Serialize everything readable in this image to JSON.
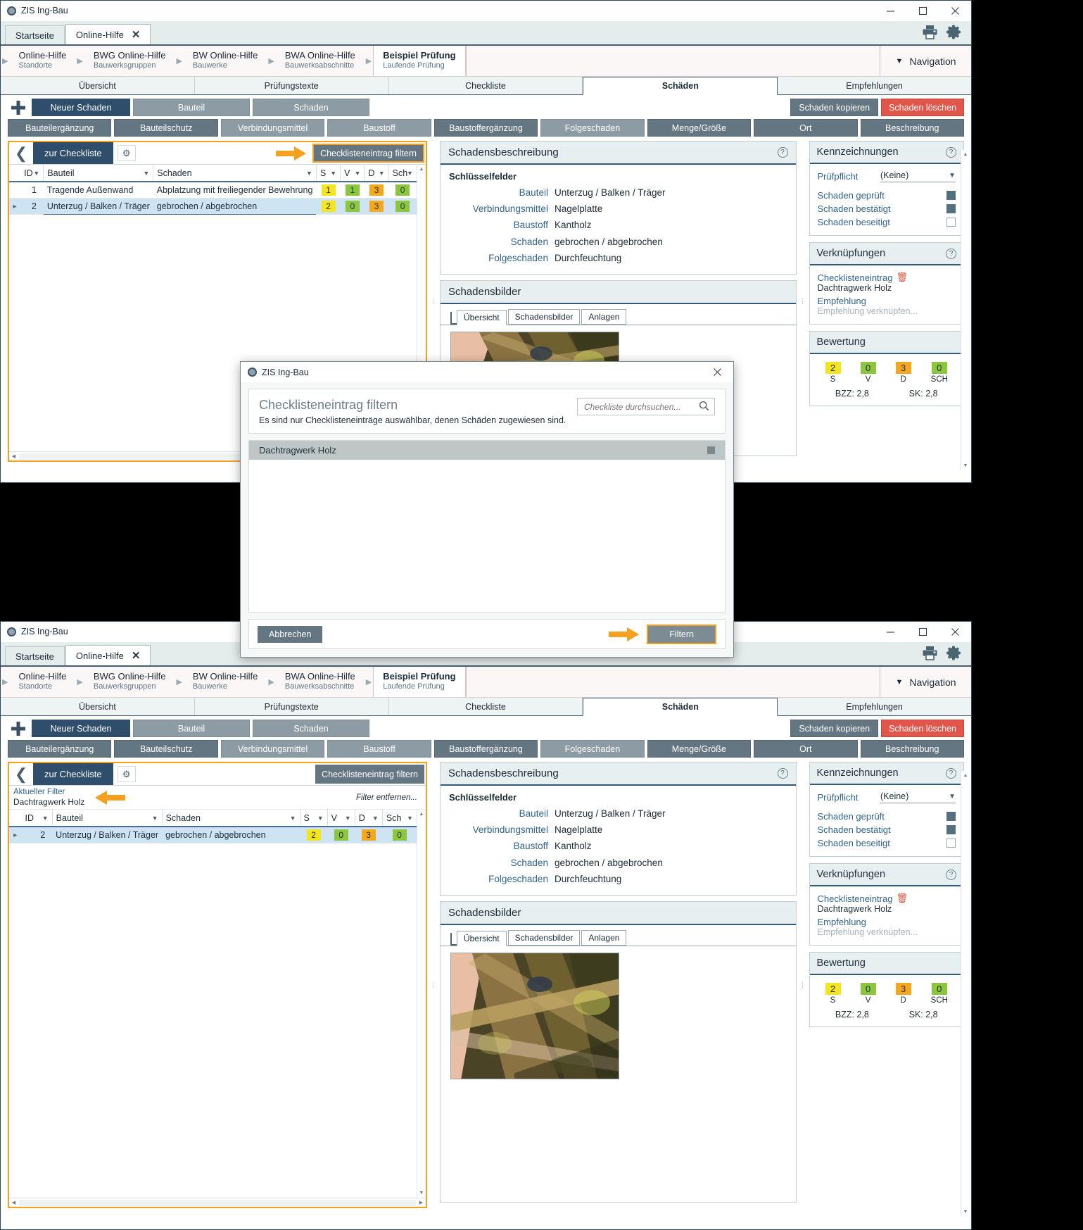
{
  "app": {
    "title": "ZIS Ing-Bau"
  },
  "window_controls": {
    "minimize": "minimize-icon",
    "maximize": "maximize-icon",
    "close": "close-icon"
  },
  "tabs": [
    {
      "label": "Startseite",
      "active": false,
      "closable": false
    },
    {
      "label": "Online-Hilfe",
      "active": true,
      "closable": true
    }
  ],
  "tab_icons": {
    "print": "print-icon",
    "settings": "gear-icon"
  },
  "breadcrumb": {
    "items": [
      {
        "title": "Online-Hilfe",
        "subtitle": "Standorte",
        "current": false
      },
      {
        "title": "BWG Online-Hilfe",
        "subtitle": "Bauwerksgruppen",
        "current": false
      },
      {
        "title": "BW Online-Hilfe",
        "subtitle": "Bauwerke",
        "current": false
      },
      {
        "title": "BWA Online-Hilfe",
        "subtitle": "Bauwerksabschnitte",
        "current": false
      },
      {
        "title": "Beispiel Prüfung",
        "subtitle": "Laufende Prüfung",
        "current": true
      }
    ],
    "navigation_label": "Navigation"
  },
  "sections": [
    {
      "label": "Übersicht",
      "active": false
    },
    {
      "label": "Prüfungstexte",
      "active": false
    },
    {
      "label": "Checkliste",
      "active": false
    },
    {
      "label": "Schäden",
      "active": true
    },
    {
      "label": "Empfehlungen",
      "active": false
    }
  ],
  "commandbar": {
    "new_damage": "Neuer Schaden",
    "row1": [
      "Bauteil",
      "Schaden"
    ],
    "copy": "Schaden kopieren",
    "delete": "Schaden löschen",
    "row2": [
      "Bauteilergänzung",
      "Bauteilschutz",
      "Verbindungsmittel",
      "Baustoff",
      "Baustoffergänzung",
      "Folgeschaden",
      "Menge/Größe",
      "Ort",
      "Beschreibung"
    ]
  },
  "grid_toolbar": {
    "back_label": "zur Checkliste",
    "settings_icon": "gear-icon",
    "filter_button": "Checklisteneintrag filtern"
  },
  "filter_info": {
    "label": "Aktueller Filter",
    "value": "Dachtragwerk Holz",
    "remove": "Filter entfernen..."
  },
  "grid": {
    "columns": [
      "ID",
      "Bauteil",
      "Schaden",
      "S",
      "V",
      "D",
      "Sch"
    ],
    "rows_unfiltered": [
      {
        "id": "1",
        "bauteil": "Tragende Außenwand",
        "schaden": "Abplatzung mit freiliegender Bewehrung",
        "s": "1",
        "v": "1",
        "d": "3",
        "sch": "0",
        "s_color": "yellow",
        "v_color": "green",
        "d_color": "orange",
        "sch_color": "green",
        "selected": false
      },
      {
        "id": "2",
        "bauteil": "Unterzug / Balken / Träger",
        "schaden": "gebrochen / abgebrochen",
        "s": "2",
        "v": "0",
        "d": "3",
        "sch": "0",
        "s_color": "yellow",
        "v_color": "green",
        "d_color": "orange",
        "sch_color": "green",
        "selected": true
      }
    ],
    "rows_filtered": [
      {
        "id": "2",
        "bauteil": "Unterzug / Balken / Träger",
        "schaden": "gebrochen / abgebrochen",
        "s": "2",
        "v": "0",
        "d": "3",
        "sch": "0",
        "s_color": "yellow",
        "v_color": "green",
        "d_color": "orange",
        "sch_color": "green",
        "selected": true
      }
    ]
  },
  "description_card": {
    "title": "Schadensbeschreibung",
    "help": "help-icon",
    "keyfields_title": "Schlüsselfelder",
    "fields": [
      {
        "key": "Bauteil",
        "value": "Unterzug / Balken / Träger"
      },
      {
        "key": "Verbindungsmittel",
        "value": "Nagelplatte"
      },
      {
        "key": "Baustoff",
        "value": "Kantholz"
      },
      {
        "key": "Schaden",
        "value": "gebrochen / abgebrochen"
      },
      {
        "key": "Folgeschaden",
        "value": "Durchfeuchtung"
      }
    ]
  },
  "images_card": {
    "title": "Schadensbilder",
    "tabs": [
      {
        "label": "Übersicht",
        "active": true
      },
      {
        "label": "Schadensbilder",
        "active": false
      },
      {
        "label": "Anlagen",
        "active": false
      }
    ]
  },
  "kennzeichnungen": {
    "title": "Kennzeichnungen",
    "help": "help-icon",
    "pruefpflicht_label": "Prüfpflicht",
    "pruefpflicht_value": "(Keine)",
    "checks": [
      {
        "label": "Schaden geprüft",
        "checked": true
      },
      {
        "label": "Schaden bestätigt",
        "checked": true
      },
      {
        "label": "Schaden beseitigt",
        "checked": false
      }
    ]
  },
  "verknuepfungen": {
    "title": "Verknüpfungen",
    "help": "help-icon",
    "checklist_link": "Checklisteneintrag",
    "checklist_value": "Dachtragwerk Holz",
    "delete_icon": "trash-icon",
    "recommendation_link": "Empfehlung",
    "recommendation_value": "Empfehlung verknüpfen..."
  },
  "bewertung": {
    "title": "Bewertung",
    "cells": [
      {
        "value": "2",
        "label": "S",
        "color": "yellow"
      },
      {
        "value": "0",
        "label": "V",
        "color": "green"
      },
      {
        "value": "3",
        "label": "D",
        "color": "orange"
      },
      {
        "value": "0",
        "label": "SCH",
        "color": "green"
      }
    ],
    "bzz": "BZZ: 2,8",
    "sk": "SK: 2,8"
  },
  "modal": {
    "window_title": "ZIS Ing-Bau",
    "close_icon": "close-icon",
    "heading": "Checklisteneintrag filtern",
    "subtitle": "Es sind nur Checklisteneinträge auswählbar, denen Schäden zugewiesen sind.",
    "search_placeholder": "Checkliste durchsuchen...",
    "search_icon": "search-icon",
    "items": [
      {
        "label": "Dachtragwerk Holz",
        "checked": true
      }
    ],
    "cancel": "Abbrechen",
    "confirm": "Filtern"
  },
  "colors": {
    "accent_blue": "#2f4e6b",
    "header_rule": "#355a77",
    "link_blue": "#31648e",
    "highlight_orange": "#f5a01e",
    "danger_red": "#e0564a",
    "badge_green": "#8cc63f",
    "badge_yellow": "#f5e51e",
    "badge_orange": "#f5a81e",
    "row_selected": "#cfe4f2"
  }
}
